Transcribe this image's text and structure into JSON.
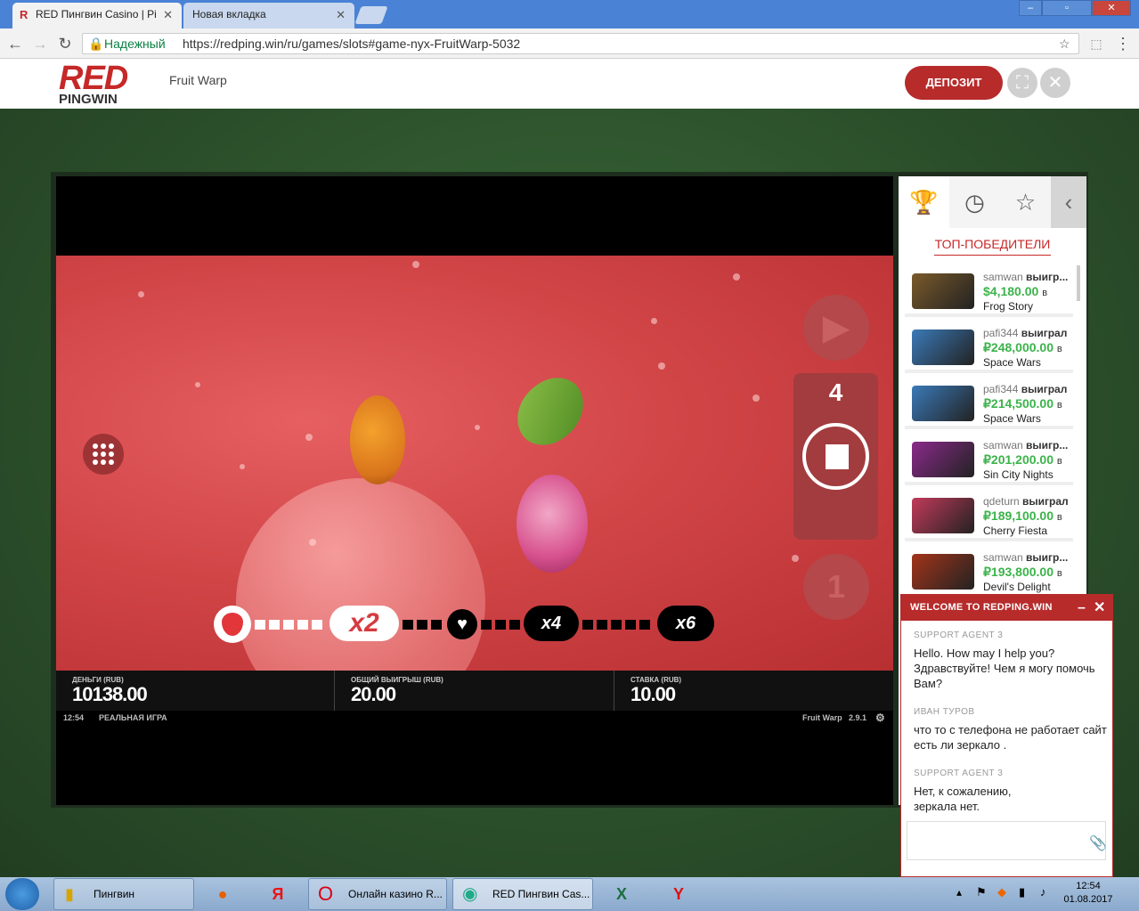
{
  "browser": {
    "tabs": [
      {
        "label": "RED Пингвин Casino | Pi",
        "favicon": "R",
        "active": true
      },
      {
        "label": "Новая вкладка",
        "active": false
      }
    ],
    "secure_label": "Надежный",
    "url": "https://redping.win/ru/games/slots#game-nyx-FruitWarp-5032",
    "window_controls": [
      "minimize-icon",
      "restore-icon",
      "close-icon"
    ]
  },
  "site": {
    "logo_top": "RED",
    "logo_bottom": "PINGWIN",
    "game_title": "Fruit Warp",
    "deposit_label": "ДЕПОЗИТ"
  },
  "game": {
    "spins_left": "4",
    "multipliers": [
      "x2",
      "x4",
      "x6"
    ],
    "stats": [
      {
        "label": "ДЕНЬГИ (RUB)",
        "value": "10138.00"
      },
      {
        "label": "ОБЩИЙ ВЫИГРЫШ (RUB)",
        "value": "20.00"
      },
      {
        "label": "СТАВКА (RUB)",
        "value": "10.00"
      }
    ],
    "footer": {
      "time": "12:54",
      "mode": "РЕАЛЬНАЯ ИГРА",
      "name": "Fruit Warp",
      "version": "2.9.1"
    }
  },
  "side_panel": {
    "tabs": [
      "trophy-icon",
      "clock-icon",
      "star-icon",
      "chevron-left-icon"
    ],
    "title": "ТОП-ПОБЕДИТЕЛИ",
    "winners": [
      {
        "user": "samwan",
        "action": "выигр...",
        "amount": "$4,180.00",
        "in": "в",
        "game": "Frog Story",
        "color": "#7a5a2a"
      },
      {
        "user": "pafi344",
        "action": "выиграл",
        "amount": "₽248,000.00",
        "in": "в",
        "game": "Space Wars",
        "color": "#3a7ab8"
      },
      {
        "user": "pafi344",
        "action": "выиграл",
        "amount": "₽214,500.00",
        "in": "в",
        "game": "Space Wars",
        "color": "#3a7ab8"
      },
      {
        "user": "samwan",
        "action": "выигр...",
        "amount": "₽201,200.00",
        "in": "в",
        "game": "Sin City Nights",
        "color": "#8a2a8a"
      },
      {
        "user": "qdeturn",
        "action": "выиграл",
        "amount": "₽189,100.00",
        "in": "в",
        "game": "Cherry Fiesta",
        "color": "#c23a5a"
      },
      {
        "user": "samwan",
        "action": "выигр...",
        "amount": "₽193,800.00",
        "in": "в",
        "game": "Devil's Delight",
        "color": "#a3341a"
      }
    ]
  },
  "chat": {
    "header": "WELCOME TO REDPING.WIN",
    "messages": [
      {
        "author": "SUPPORT AGENT 3",
        "text": "Hello. How may I help you? Здравствуйте! Чем я могу помочь Вам?"
      },
      {
        "author": "ИВАН ТУРОВ",
        "text": "что то с телефона не работает сайт есть ли зеркало ."
      },
      {
        "author": "SUPPORT AGENT 3",
        "text": "Нет, к сожалению, зеркала нет."
      }
    ]
  },
  "taskbar": {
    "items": [
      {
        "label": "Пингвин"
      },
      {
        "label": "Онлайн казино R..."
      },
      {
        "label": "RED Пингвин Cas..."
      }
    ],
    "icons": {
      "yandex_letter": "Я",
      "yandex_browser": "Y",
      "excel": "X"
    },
    "time": "12:54",
    "date": "01.08.2017"
  }
}
